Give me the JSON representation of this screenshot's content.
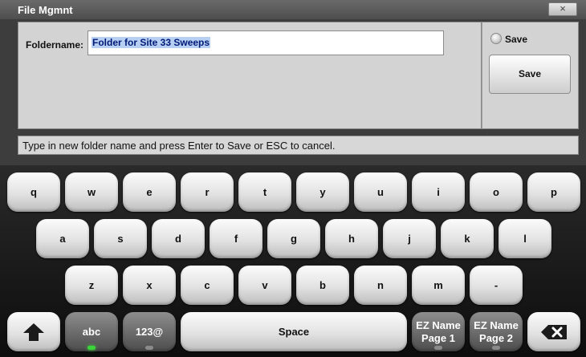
{
  "dialog": {
    "title": "File Mgmnt",
    "close_label": "×",
    "foldername_label": "Foldername:",
    "foldername_value": "Folder for Site 33 Sweeps",
    "save_radio_label": "Save",
    "save_button_label": "Save",
    "status_text": "Type in new folder name and press Enter to Save or ESC to cancel."
  },
  "keyboard": {
    "row1": [
      "q",
      "w",
      "e",
      "r",
      "t",
      "y",
      "u",
      "i",
      "o",
      "p"
    ],
    "row2": [
      "a",
      "s",
      "d",
      "f",
      "g",
      "h",
      "j",
      "k",
      "l"
    ],
    "row3": [
      "z",
      "x",
      "c",
      "v",
      "b",
      "n",
      "m",
      "-"
    ],
    "shift_icon": "shift-arrow-icon",
    "abc_label": "abc",
    "num_label": "123@",
    "space_label": "Space",
    "ez1_line1": "EZ Name",
    "ez1_line2": "Page 1",
    "ez2_line1": "EZ Name",
    "ez2_line2": "Page 2",
    "backspace_icon": "backspace-icon",
    "active_mode": "abc"
  }
}
